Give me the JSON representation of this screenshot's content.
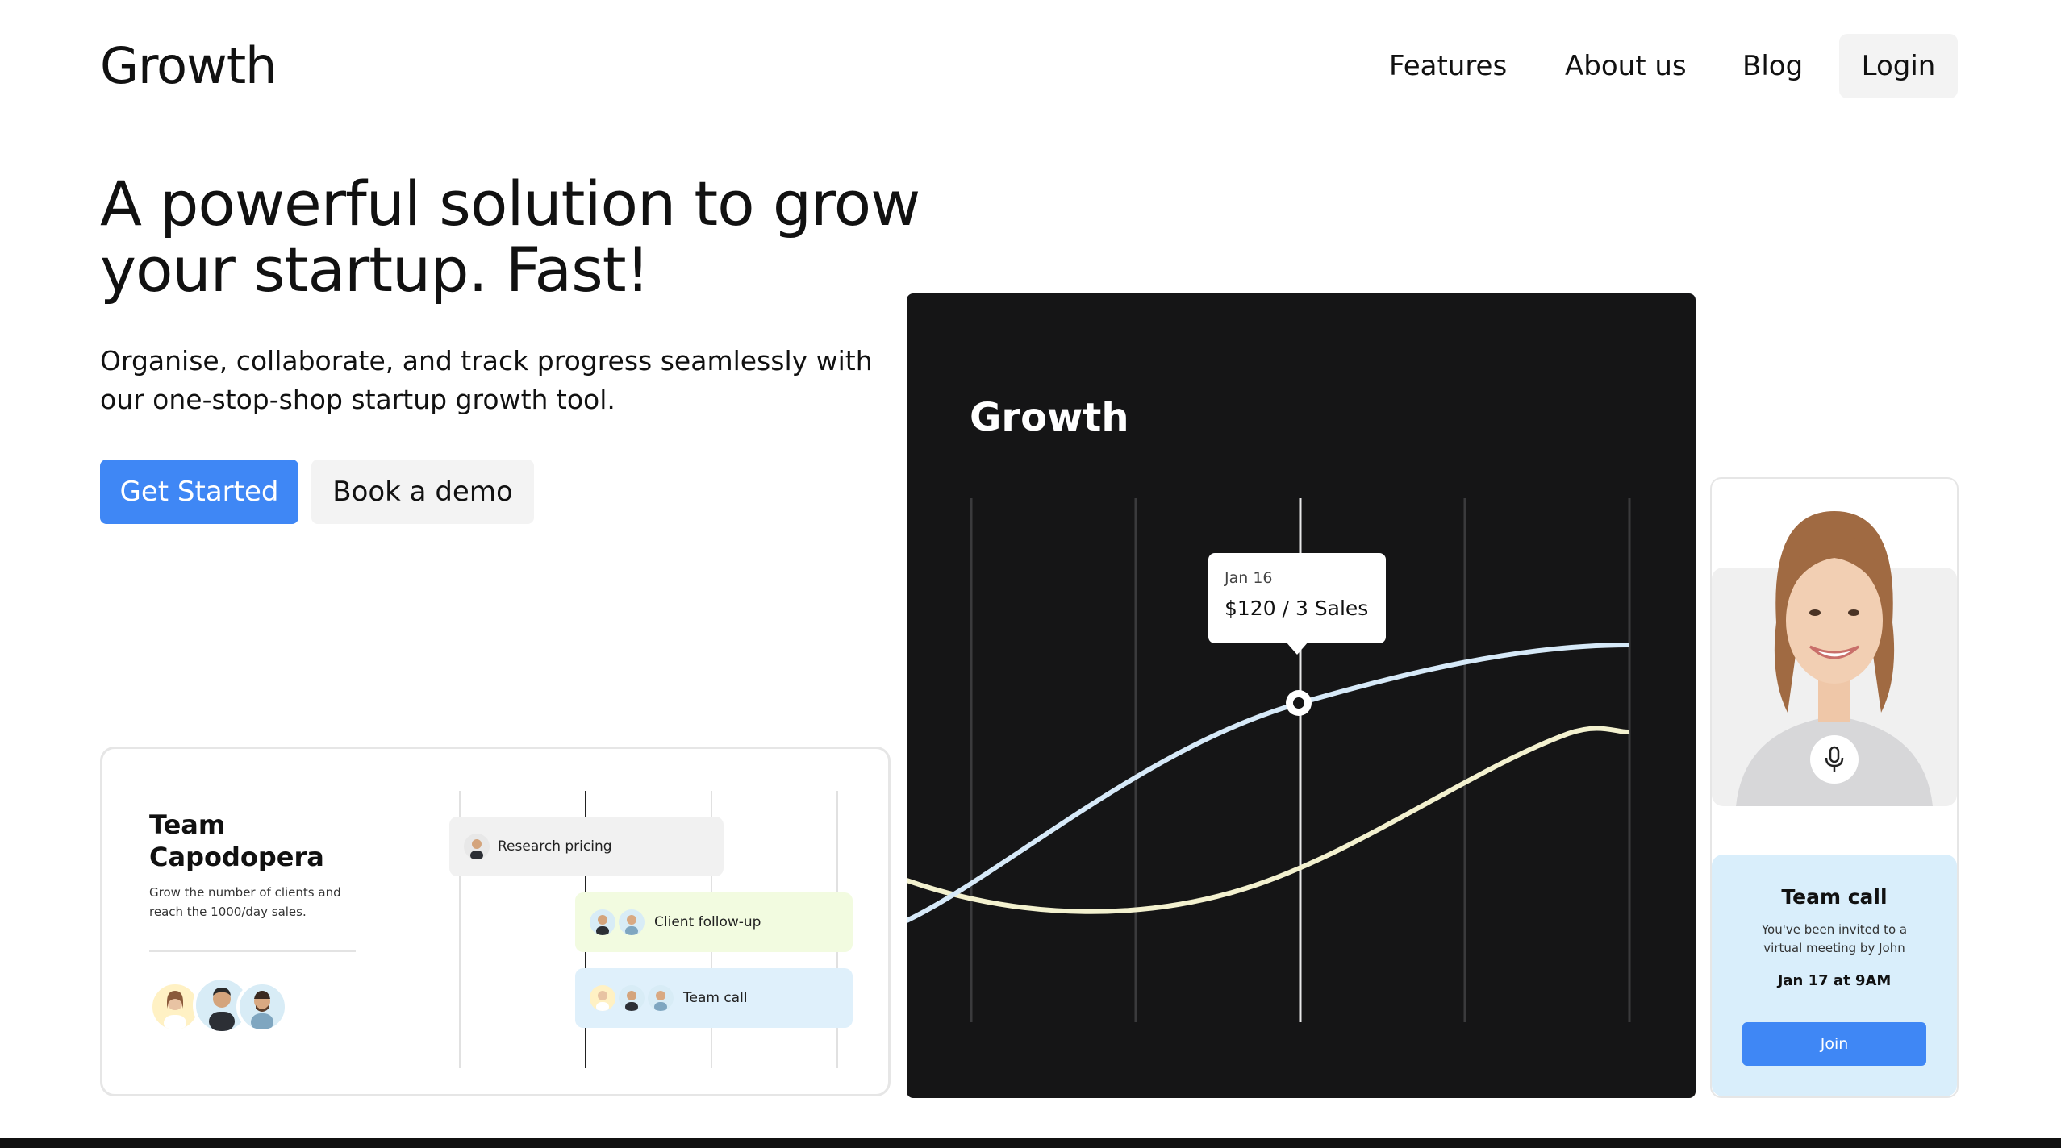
{
  "header": {
    "logo": "Growth",
    "nav": [
      "Features",
      "About us",
      "Blog"
    ],
    "login_label": "Login"
  },
  "hero": {
    "title": "A powerful solution to grow your startup. Fast!",
    "subtitle": "Organise, collaborate, and track progress seamlessly with our one-stop-shop startup growth tool.",
    "primary_cta": "Get Started",
    "secondary_cta": "Book a demo"
  },
  "team_card": {
    "name": "Team Capodopera",
    "description": "Grow the number of clients and reach the 1000/day sales.",
    "tasks": [
      {
        "label": "Research pricing"
      },
      {
        "label": "Client follow-up"
      },
      {
        "label": "Team call"
      }
    ]
  },
  "chart_card": {
    "title": "Growth",
    "tooltip_date": "Jan 16",
    "tooltip_value": "$120 / 3 Sales",
    "colors": {
      "background": "#151516",
      "line_primary": "#d6e9f8",
      "line_secondary": "#f3f1cf"
    }
  },
  "video_card": {
    "call_title": "Team call",
    "call_description": "You've been invited to a virtual meeting by John",
    "call_time": "Jan 17 at 9AM",
    "join_label": "Join"
  },
  "colors": {
    "accent": "#3f87f5",
    "button_secondary": "#f3f3f3"
  }
}
